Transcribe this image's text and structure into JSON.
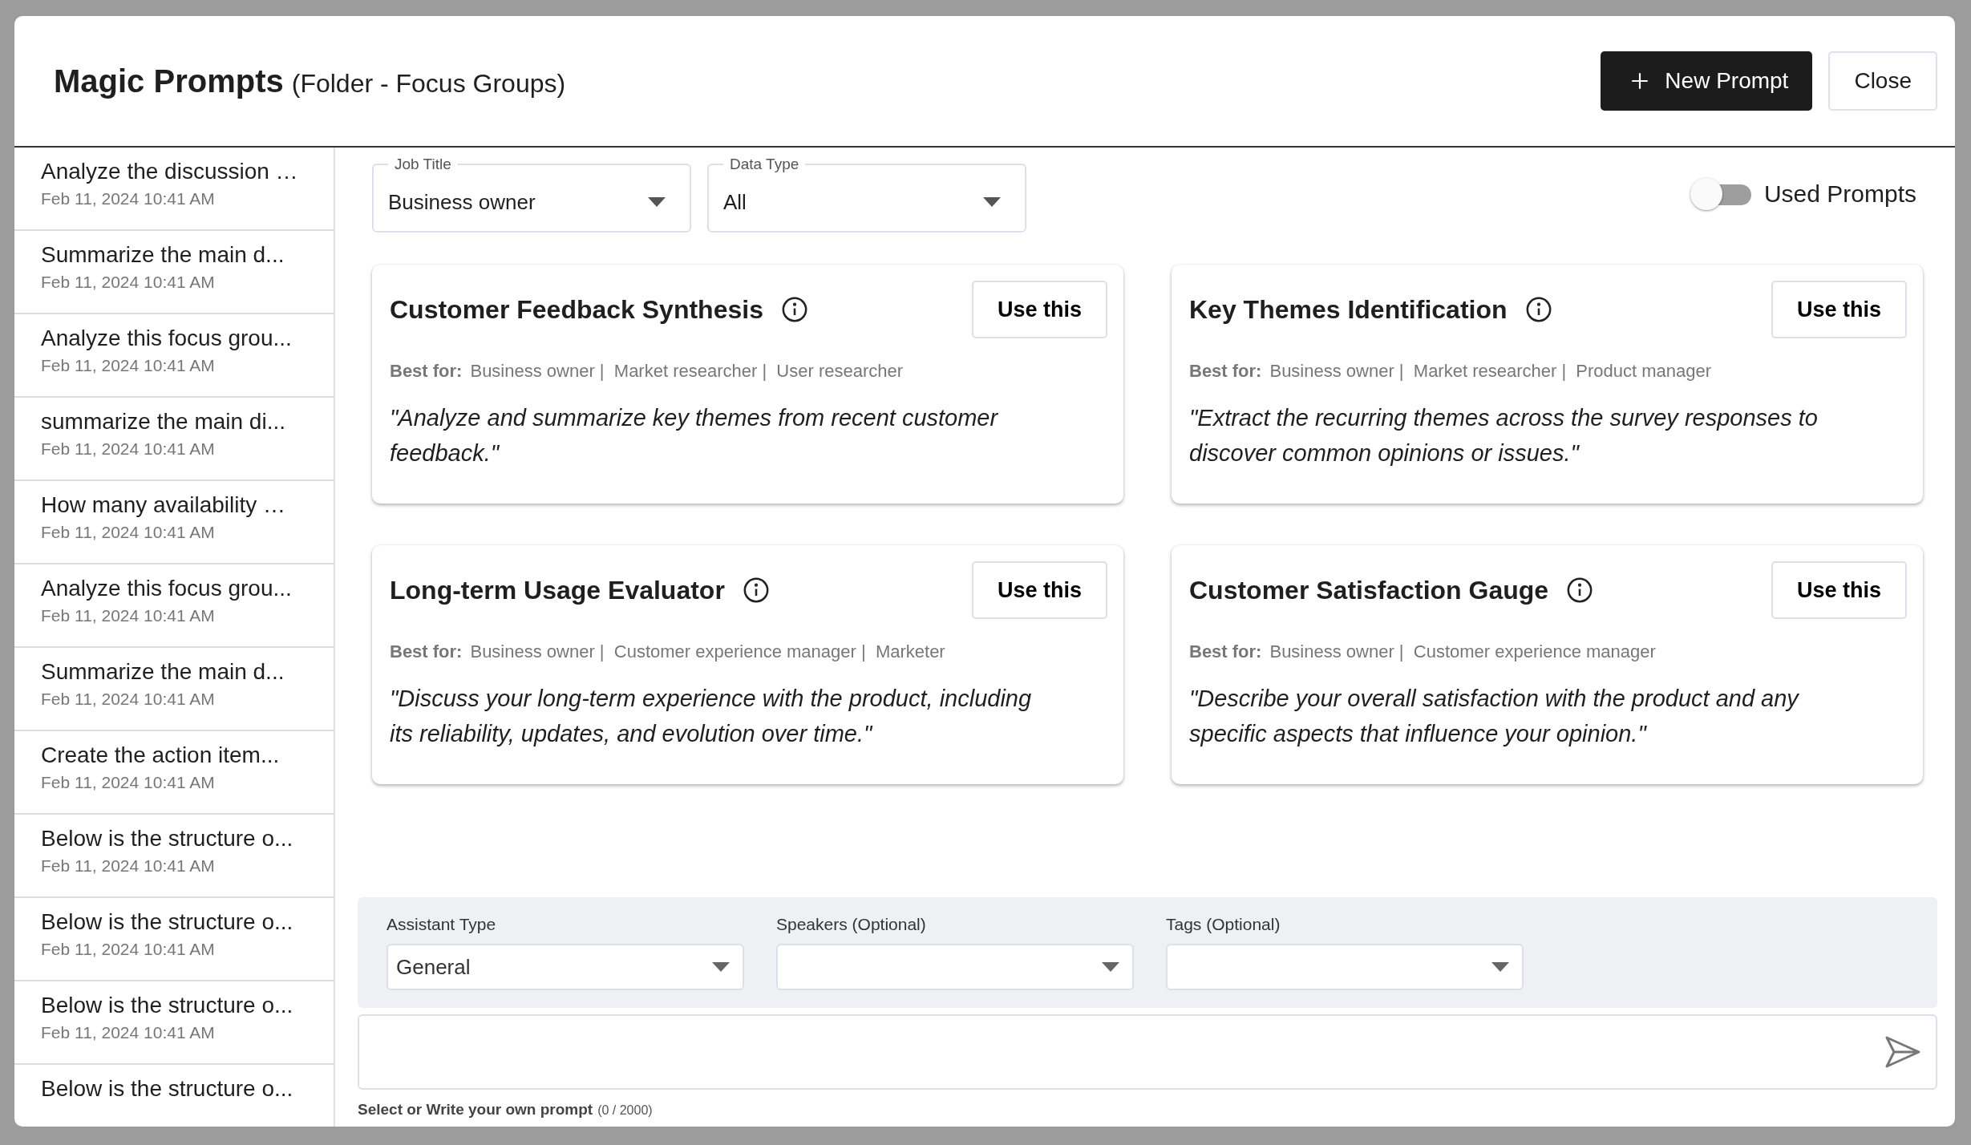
{
  "dialog": {
    "title": "Magic Prompts",
    "subtitle": "(Folder - Focus Groups)",
    "buttons": [
      {
        "kind": "primary",
        "label": "New Prompt"
      },
      {
        "kind": "secondary",
        "label": "Close"
      }
    ]
  },
  "sidebar": {
    "items": [
      {
        "title": "Analyze the discussion …",
        "date": "Feb 11, 2024 10:41 AM"
      },
      {
        "title": "Summarize the main d...",
        "date": "Feb 11, 2024 10:41 AM"
      },
      {
        "title": "Analyze this focus grou...",
        "date": "Feb 11, 2024 10:41 AM"
      },
      {
        "title": "summarize the main di...",
        "date": "Feb 11, 2024 10:41 AM"
      },
      {
        "title": "How many availability …",
        "date": "Feb 11, 2024 10:41 AM"
      },
      {
        "title": "Analyze this focus grou...",
        "date": "Feb 11, 2024 10:41 AM"
      },
      {
        "title": "Summarize the main d...",
        "date": "Feb 11, 2024 10:41 AM"
      },
      {
        "title": "Create the action item...",
        "date": "Feb 11, 2024 10:41 AM"
      },
      {
        "title": "Below is the structure o...",
        "date": "Feb 11, 2024 10:41 AM"
      },
      {
        "title": "Below is the structure o...",
        "date": "Feb 11, 2024 10:41 AM"
      },
      {
        "title": "Below is the structure o...",
        "date": "Feb 11, 2024 10:41 AM"
      },
      {
        "title": "Below is the structure o..."
      }
    ]
  },
  "filters": [
    {
      "label": "Job Title",
      "value": "Business owner"
    },
    {
      "label": "Data Type",
      "value": "All"
    }
  ],
  "used_prompts_toggle": {
    "label": "Used Prompts",
    "on": false
  },
  "cards": [
    {
      "title": "Customer Feedback Synthesis",
      "button": "Use this",
      "best_for_label": "Best for:",
      "best_for": "Business owner |  Market researcher |  User researcher",
      "quote": "\"Analyze and summarize key themes from recent customer feedback.\""
    },
    {
      "title": "Key Themes Identification",
      "button": "Use this",
      "best_for_label": "Best for:",
      "best_for": "Business owner |  Market researcher |  Product manager",
      "quote": "\"Extract the recurring themes across the survey responses to discover common opinions or issues.\""
    },
    {
      "title": "Long-term Usage Evaluator",
      "button": "Use this",
      "best_for_label": "Best for:",
      "best_for": "Business owner |  Customer experience manager |  Marketer",
      "quote": "\"Discuss your long-term experience with the product, including its reliability, updates, and evolution over time.\""
    },
    {
      "title": "Customer Satisfaction Gauge",
      "button": "Use this",
      "best_for_label": "Best for:",
      "best_for": "Business owner |  Customer experience manager",
      "quote": "\"Describe your overall satisfaction with the product and any specific aspects that influence your opinion.\""
    }
  ],
  "assistant_options": [
    {
      "label": "Assistant Type",
      "value": "General"
    },
    {
      "label": "Speakers (Optional)"
    },
    {
      "label": "Tags (Optional)"
    }
  ],
  "prompt_input": {
    "caption": "Select or Write your own prompt",
    "counter": "(0 / 2000)"
  }
}
